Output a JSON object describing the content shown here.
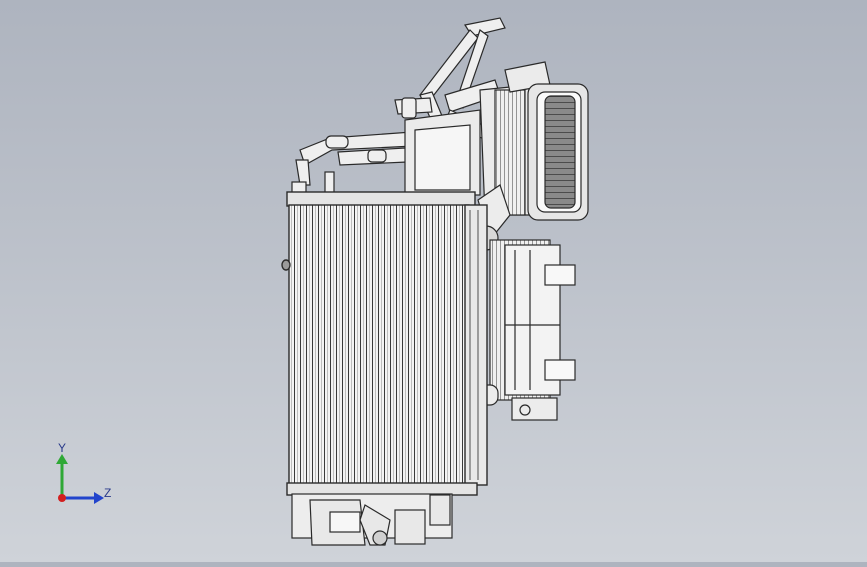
{
  "viewport": {
    "background_top": "#aeb4bf",
    "background_bottom": "#cfd3d9"
  },
  "model": {
    "icon": "radiator-hvac-assembly-icon",
    "line_color": "#2a2a2a",
    "fill_color": "#f2f2f2"
  },
  "triad": {
    "y_label": "Y",
    "z_label": "Z",
    "y_color": "#2fa836",
    "z_color": "#2244cc",
    "x_color": "#d21f1f"
  }
}
